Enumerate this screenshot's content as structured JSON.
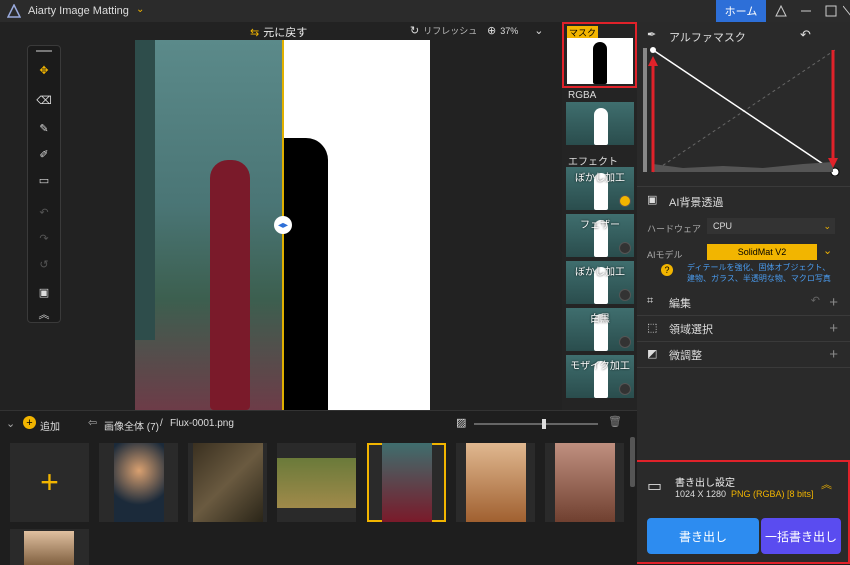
{
  "app": {
    "title": "Aiarty Image Matting",
    "home_button": "ホーム"
  },
  "toolbar": {
    "undo_label": "元に戻す",
    "refresh_label": "リフレッシュ",
    "zoom": "37%"
  },
  "thumbs": {
    "mask": "マスク",
    "rgba": "RGBA",
    "effect": "エフェクト",
    "items": [
      "ぼかし加工",
      "フェザー",
      "ぼかし加工",
      "白黒",
      "モザイク加工"
    ]
  },
  "alpha": {
    "title": "アルファマスク"
  },
  "ai": {
    "title": "AI背景透過",
    "hardware_label": "ハードウェア",
    "hardware_value": "CPU",
    "model_label": "AIモデル",
    "model_value": "SolidMat  V2",
    "model_desc": "ディテールを強化、固体オブジェクト、建物、ガラス、半透明な物、マクロ写真"
  },
  "sections": {
    "edit": "編集",
    "region": "領域選択",
    "fine": "微調整"
  },
  "export": {
    "title": "書き出し設定",
    "size": "1024 X 1280",
    "format": "PNG (RGBA) [8 bits]",
    "export_btn": "書き出し",
    "batch_btn": "一括書き出し"
  },
  "film": {
    "add": "追加",
    "breadcrumb_all": "画像全体 (7)",
    "breadcrumb_file": "Flux-0001.png"
  },
  "colors": {
    "accent": "#f2b500",
    "blue": "#2d8cf0",
    "red": "#e0222a"
  }
}
